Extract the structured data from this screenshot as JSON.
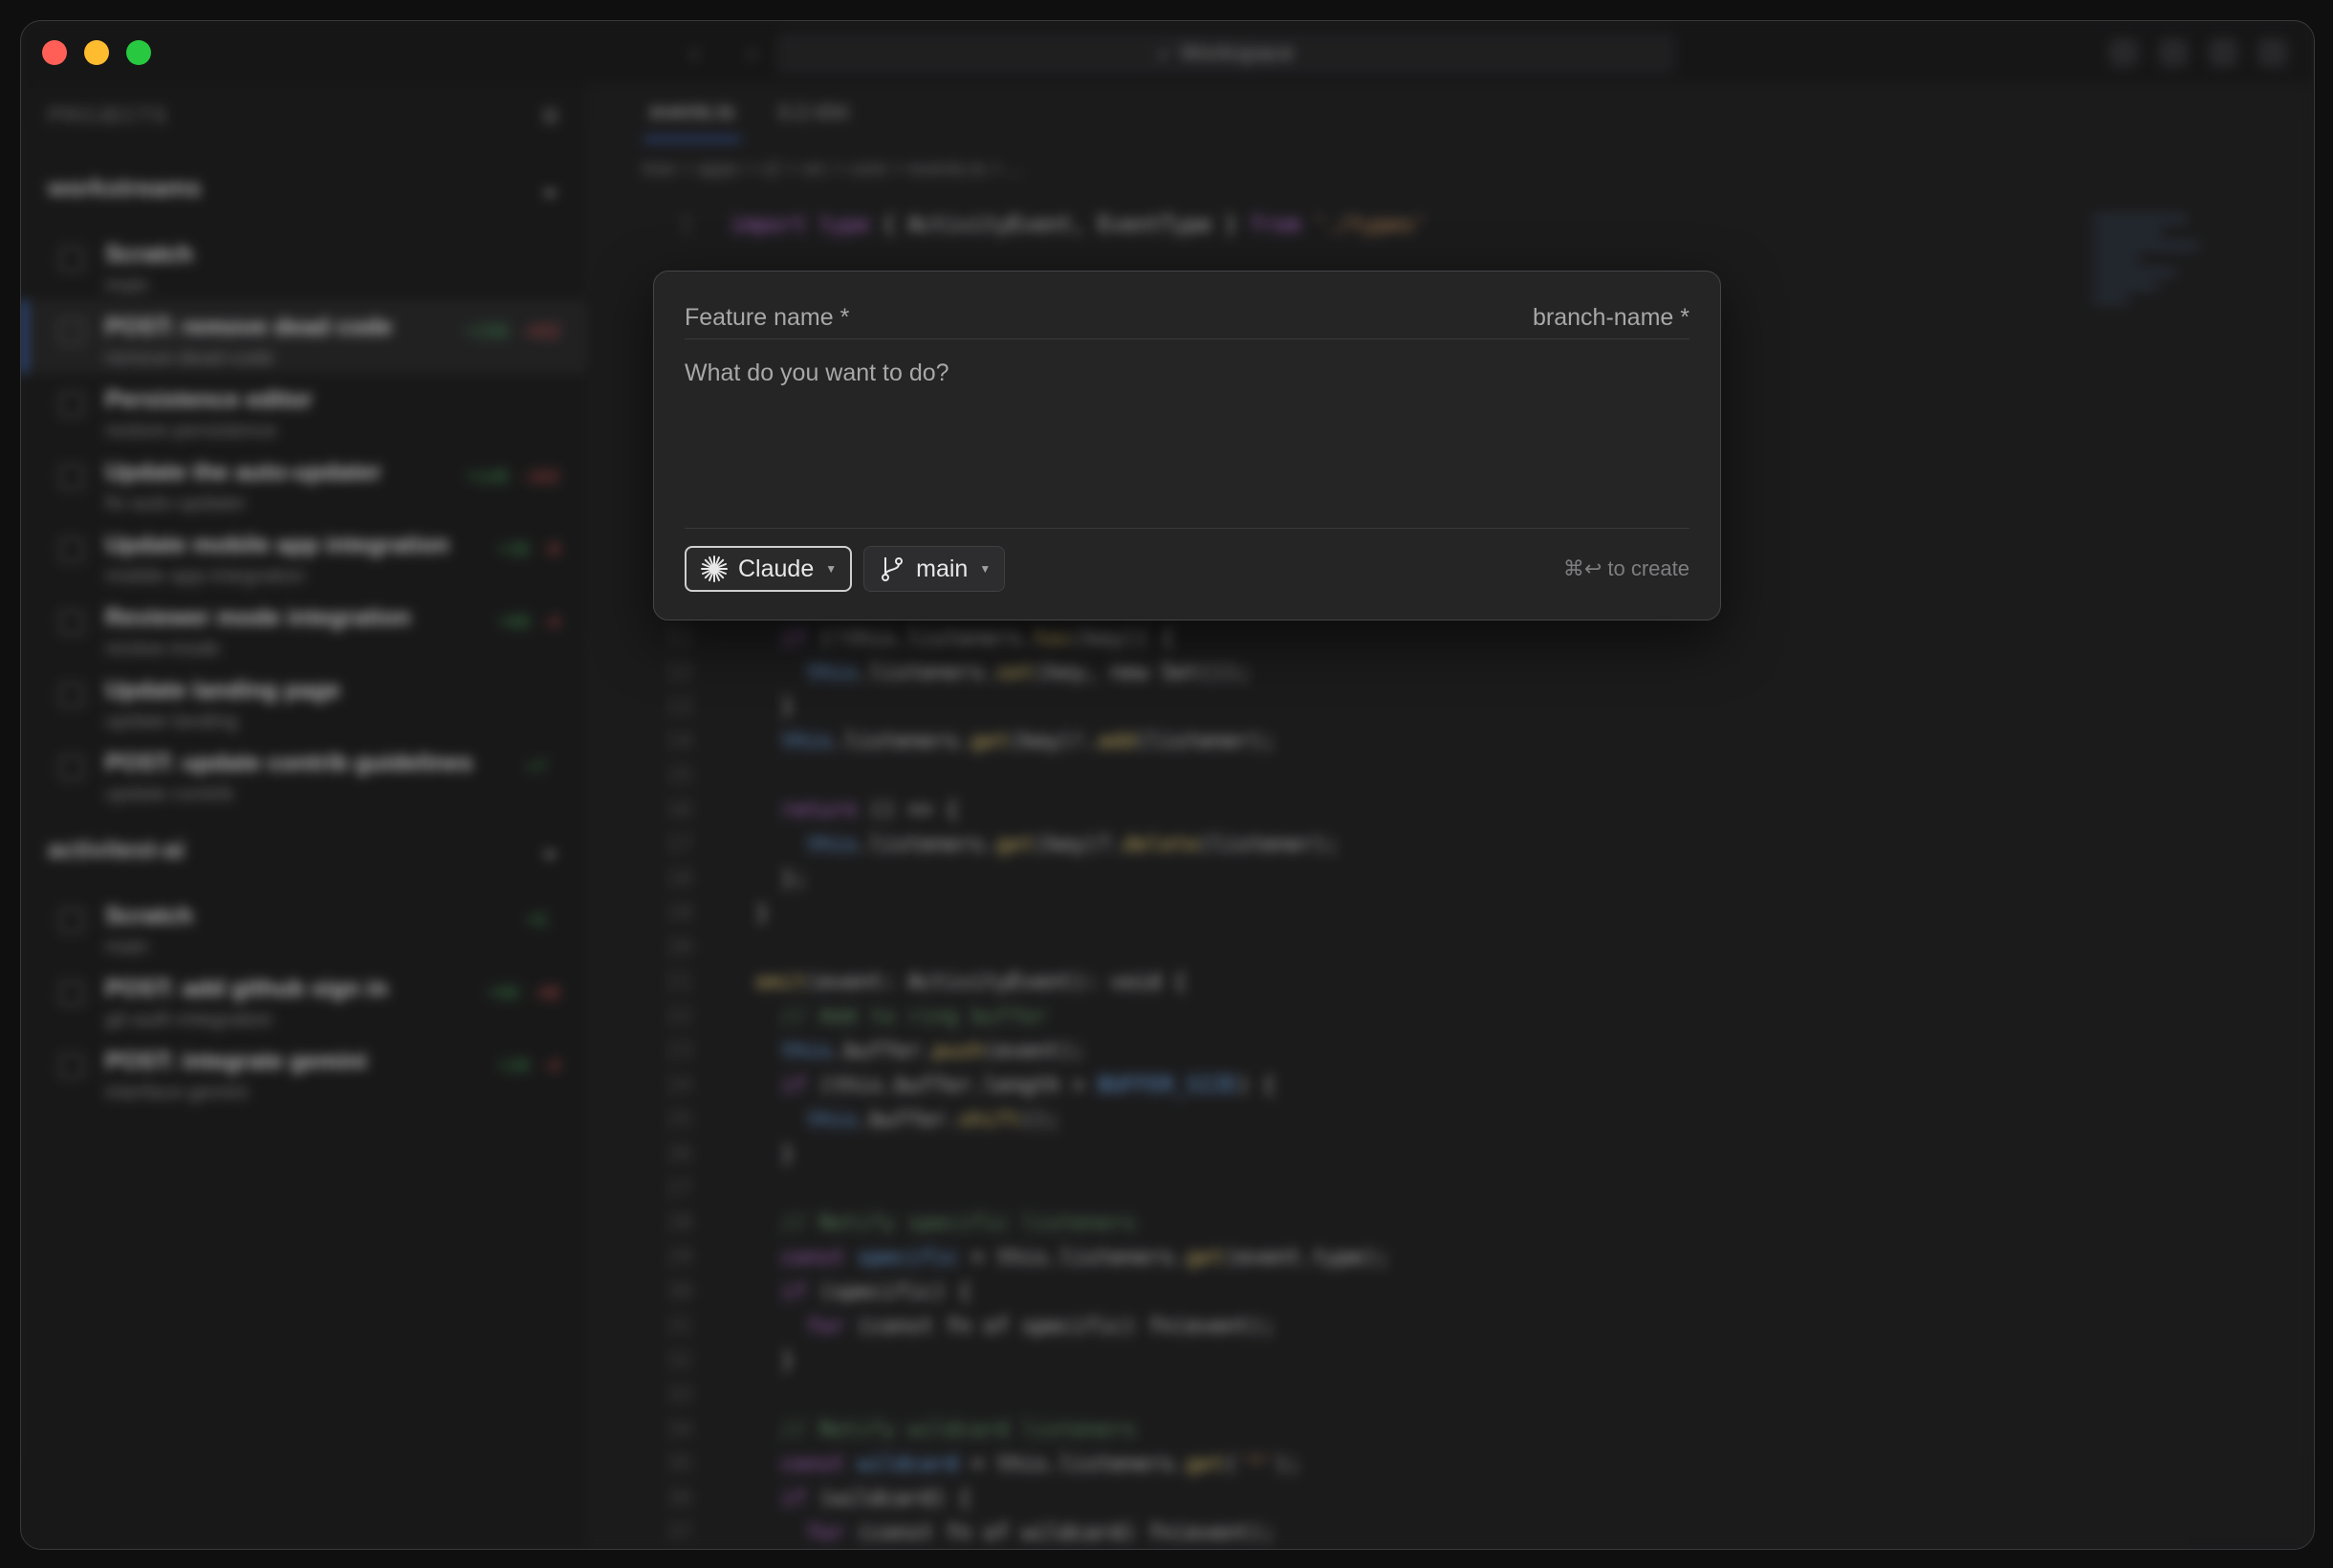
{
  "window": {
    "title": "Workspace",
    "lights": {
      "close": "#ff5f57",
      "minimize": "#febc2e",
      "maximize": "#28c840"
    }
  },
  "sidebar": {
    "header": "PROJECTS",
    "groups": [
      {
        "name": "workstreams",
        "items": [
          {
            "title": "Scratch",
            "subtitle": "main",
            "add": "",
            "del": ""
          },
          {
            "title": "POST: remove dead code",
            "subtitle": "remove-dead-code",
            "add": "+156",
            "del": "-432",
            "active": true
          },
          {
            "title": "Persistence editor",
            "subtitle": "restore-persistence",
            "add": "",
            "del": ""
          },
          {
            "title": "Update the auto-updater",
            "subtitle": "fix-auto-updater",
            "add": "+148",
            "del": "-162"
          },
          {
            "title": "Update mobile app integration",
            "subtitle": "mobile-app-integration",
            "add": "+36",
            "del": "-8"
          },
          {
            "title": "Reviewer mode integration",
            "subtitle": "review-mode",
            "add": "+88",
            "del": "-4"
          },
          {
            "title": "Update landing page",
            "subtitle": "update-landing",
            "add": "",
            "del": ""
          },
          {
            "title": "POST: update contrib guidelines",
            "subtitle": "update-contrib",
            "add": "+7",
            "del": ""
          }
        ]
      },
      {
        "name": "activitest-ai",
        "items": [
          {
            "title": "Scratch",
            "subtitle": "main",
            "add": "+5",
            "del": ""
          },
          {
            "title": "POST: add github sign in",
            "subtitle": "git-auth-integration",
            "add": "+90",
            "del": "-48"
          },
          {
            "title": "POST: integrate gemini",
            "subtitle": "interface-gemini",
            "add": "+26",
            "del": "-4"
          }
        ]
      }
    ]
  },
  "editor": {
    "tabs": [
      "events.ts",
      "0:2:494"
    ],
    "breadcrumb": "tree > apps > v2 > src > core > events.ts > ..."
  },
  "modal": {
    "feature_placeholder": "Feature name *",
    "branch_placeholder": "branch-name *",
    "prompt_placeholder": "What do you want to do?",
    "agent_label": "Claude",
    "branch_label": "main",
    "hint": "⌘↩ to create"
  }
}
